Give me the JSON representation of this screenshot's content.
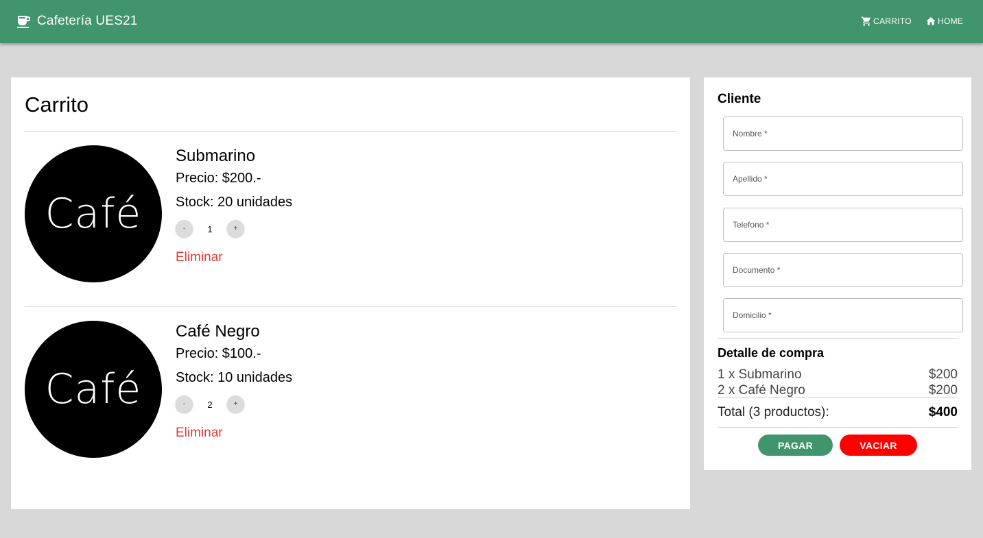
{
  "header": {
    "title": "Cafetería UES21",
    "nav": {
      "cart_label": "CARRITO",
      "home_label": "HOME"
    }
  },
  "cart": {
    "title": "Carrito",
    "items": [
      {
        "image_text": "Café",
        "name": "Submarino",
        "price": "Precio: $200.-",
        "stock": "Stock: 20 unidades",
        "minus": "-",
        "quantity": "1",
        "plus": "+",
        "remove_label": "Eliminar"
      },
      {
        "image_text": "Café",
        "name": "Café Negro",
        "price": "Precio: $100.-",
        "stock": "Stock: 10 unidades",
        "minus": "-",
        "quantity": "2",
        "plus": "+",
        "remove_label": "Eliminar"
      }
    ]
  },
  "client": {
    "title": "Cliente",
    "fields": [
      {
        "placeholder": "Nombre *",
        "value": ""
      },
      {
        "placeholder": "Apellido *",
        "value": ""
      },
      {
        "placeholder": "Telefono *",
        "value": ""
      },
      {
        "placeholder": "Documento *",
        "value": ""
      },
      {
        "placeholder": "Domicilio *",
        "value": ""
      }
    ]
  },
  "detail": {
    "title": "Detalle de compra",
    "lines": [
      {
        "desc": "1 x Submarino",
        "amount": "$200"
      },
      {
        "desc": "2 x Café Negro",
        "amount": "$200"
      }
    ],
    "total_label": "Total (3 productos):",
    "total_amount": "$400"
  },
  "actions": {
    "pay_label": "PAGAR",
    "empty_label": "VACIAR"
  },
  "colors": {
    "primary": "#41956d",
    "danger_button": "#ff0000",
    "remove_link": "#e53935",
    "background": "#d8d8d8"
  },
  "icons": {
    "brand": "coffee-cup-icon",
    "cart": "shopping-cart-icon",
    "home": "home-icon"
  }
}
